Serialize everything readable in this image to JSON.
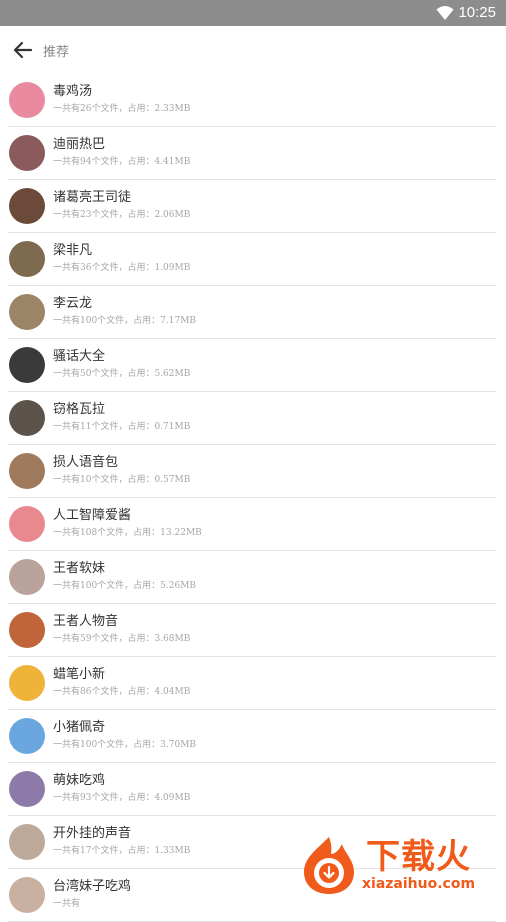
{
  "status_bar": {
    "time": "10:25"
  },
  "header": {
    "title": "推荐"
  },
  "items": [
    {
      "name": "毒鸡汤",
      "meta": "一共有26个文件，占用：2.33MB",
      "color": "#e98aa0"
    },
    {
      "name": "迪丽热巴",
      "meta": "一共有94个文件，占用：4.41MB",
      "color": "#8a5a5c"
    },
    {
      "name": "诸葛亮王司徒",
      "meta": "一共有23个文件，占用：2.06MB",
      "color": "#6b4a3a"
    },
    {
      "name": "梁非凡",
      "meta": "一共有36个文件，占用：1.09MB",
      "color": "#7d6a4f"
    },
    {
      "name": "李云龙",
      "meta": "一共有100个文件，占用：7.17MB",
      "color": "#9c8566"
    },
    {
      "name": "骚话大全",
      "meta": "一共有50个文件，占用：5.62MB",
      "color": "#3a3a3a"
    },
    {
      "name": "窃格瓦拉",
      "meta": "一共有11个文件，占用：0.71MB",
      "color": "#5c534a"
    },
    {
      "name": "损人语音包",
      "meta": "一共有10个文件，占用：0.57MB",
      "color": "#a07a5c"
    },
    {
      "name": "人工智障爱酱",
      "meta": "一共有108个文件，占用：13.22MB",
      "color": "#e8898f"
    },
    {
      "name": "王者软妹",
      "meta": "一共有100个文件，占用：5.26MB",
      "color": "#b9a39a"
    },
    {
      "name": "王者人物音",
      "meta": "一共有59个文件，占用：3.68MB",
      "color": "#c0643a"
    },
    {
      "name": "蜡笔小新",
      "meta": "一共有86个文件，占用：4.04MB",
      "color": "#f0b33a"
    },
    {
      "name": "小猪佩奇",
      "meta": "一共有100个文件，占用：3.70MB",
      "color": "#6aa7e0"
    },
    {
      "name": "萌妹吃鸡",
      "meta": "一共有93个文件，占用：4.09MB",
      "color": "#8e7aa8"
    },
    {
      "name": "开外挂的声音",
      "meta": "一共有17个文件，占用：1.33MB",
      "color": "#bda99a"
    },
    {
      "name": "台湾妹子吃鸡",
      "meta": "一共有",
      "color": "#c9b0a0"
    }
  ],
  "watermark": {
    "cn": "下载火",
    "en": "xiazaihuo.com",
    "color": "#f05a1a"
  }
}
